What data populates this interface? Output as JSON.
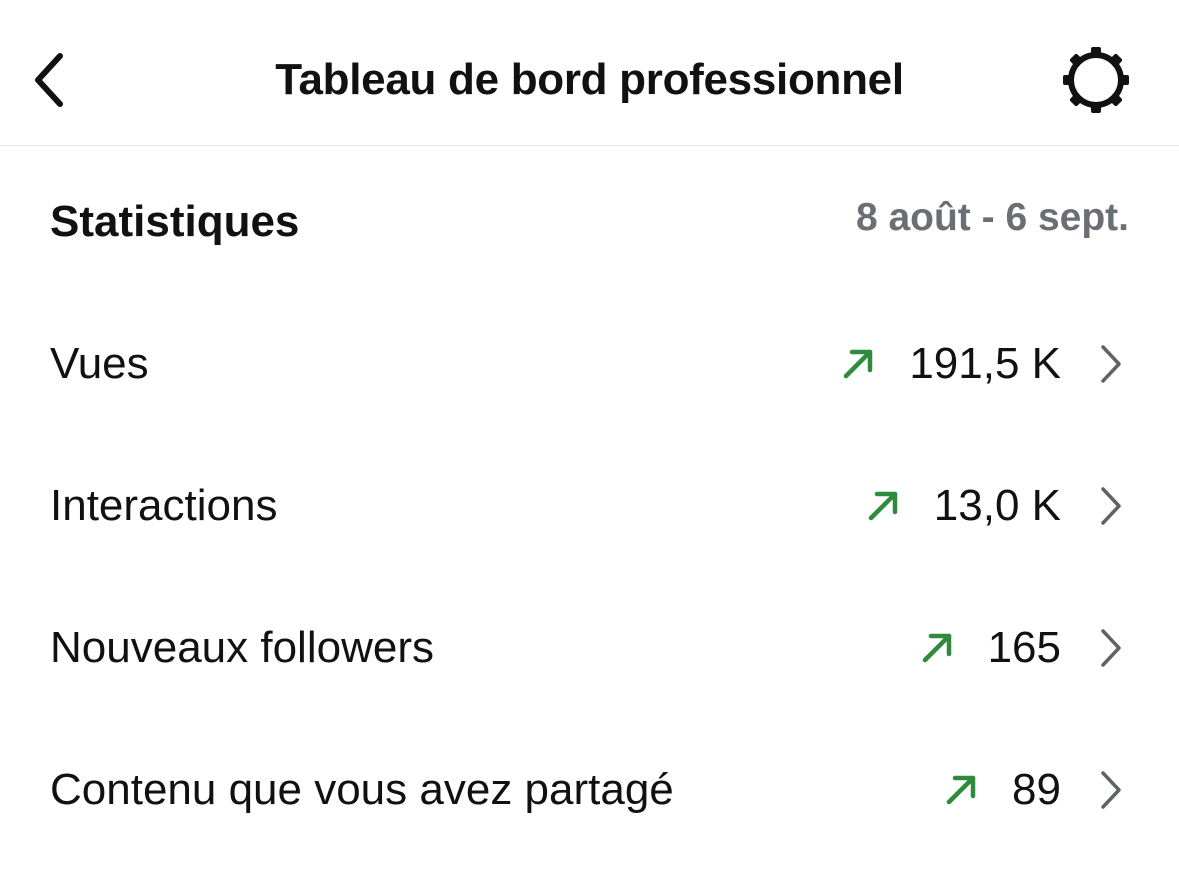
{
  "header": {
    "title": "Tableau de bord professionnel",
    "back_icon": "chevron-left-icon",
    "settings_icon": "gear-icon"
  },
  "stats": {
    "title": "Statistiques",
    "date_range": "8 août - 6 sept.",
    "trend_color": "#2e8b3e",
    "rows": [
      {
        "label": "Vues",
        "value": "191,5 K",
        "trend": "up"
      },
      {
        "label": "Interactions",
        "value": "13,0 K",
        "trend": "up"
      },
      {
        "label": "Nouveaux followers",
        "value": "165",
        "trend": "up"
      },
      {
        "label": "Contenu que vous avez partagé",
        "value": "89",
        "trend": "up"
      }
    ]
  }
}
